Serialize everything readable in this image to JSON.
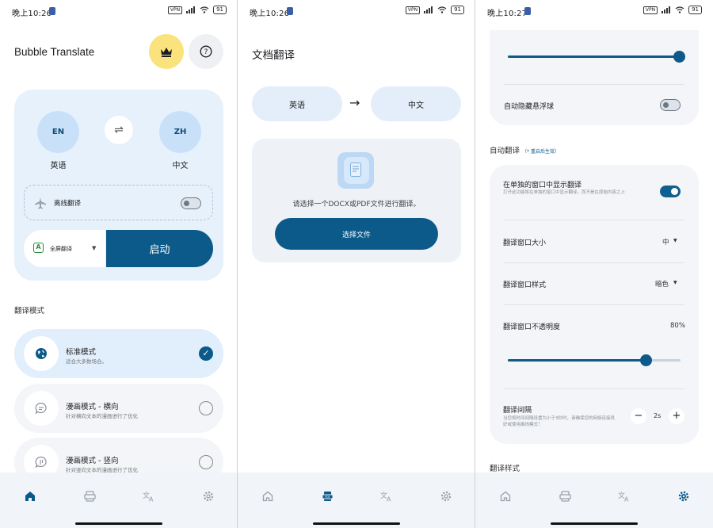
{
  "status_bars": [
    {
      "time": "晚上10:26",
      "vpn": "VPN",
      "battery": "91"
    },
    {
      "time": "晚上10:26",
      "vpn": "VPN",
      "battery": "91"
    },
    {
      "time": "晚上10:27",
      "vpn": "VPN",
      "battery": "91"
    }
  ],
  "home": {
    "app_title": "Bubble Translate",
    "source_lang": {
      "code": "EN",
      "name": "英语"
    },
    "target_lang": {
      "code": "ZH",
      "name": "中文"
    },
    "offline_label": "离线翻译",
    "offline_enabled": false,
    "mode_select_label": "全屏翻译",
    "mode_select_icon": "A",
    "start_label": "启动",
    "section_title": "翻译模式",
    "modes": [
      {
        "title": "标准模式",
        "desc": "适合大多数场合。",
        "selected": true
      },
      {
        "title": "漫画模式 - 横向",
        "desc": "针对横向文本的漫画进行了优化",
        "selected": false
      },
      {
        "title": "漫画模式 - 竖向",
        "desc": "针对竖向文本的漫画进行了优化",
        "selected": false
      }
    ]
  },
  "document": {
    "title": "文档翻译",
    "source_lang": "英语",
    "target_lang": "中文",
    "arrow": "→",
    "hint": "请选择一个DOCX或PDF文件进行翻译。",
    "choose_button": "选择文件"
  },
  "settings": {
    "top_slider_level": 1.0,
    "auto_hide_label": "自动隐藏悬浮球",
    "auto_hide_enabled": false,
    "auto_translate_title": "自动翻译",
    "auto_translate_note": "（* 重启后生效）",
    "separate_window_label": "在单独的窗口中显示翻译",
    "separate_window_desc": "打开此功能将在单独的窗口中显示翻译，而不是在原始内容之上",
    "separate_window_enabled": true,
    "window_size_label": "翻译窗口大小",
    "window_size_value": "中",
    "window_style_label": "翻译窗口样式",
    "window_style_value": "暗色",
    "opacity_label": "翻译窗口不透明度",
    "opacity_value": "80%",
    "opacity_level": 0.8,
    "interval_label": "翻译间隔",
    "interval_desc": "当您将时间间隔设置为小于3秒时，请确保您的网络连接良好或使用离线模式！",
    "interval_value": "2s",
    "minus": "−",
    "plus": "+",
    "next_section_title": "翻译样式"
  },
  "nav": {
    "items": [
      "home-icon",
      "document-icon",
      "translate-icon",
      "settings-icon"
    ],
    "active_index": [
      0,
      1,
      3
    ]
  },
  "colors": {
    "accent": "#0b5a89",
    "crown_bg": "#fae37c",
    "card_bg": "#e6f1fc"
  }
}
